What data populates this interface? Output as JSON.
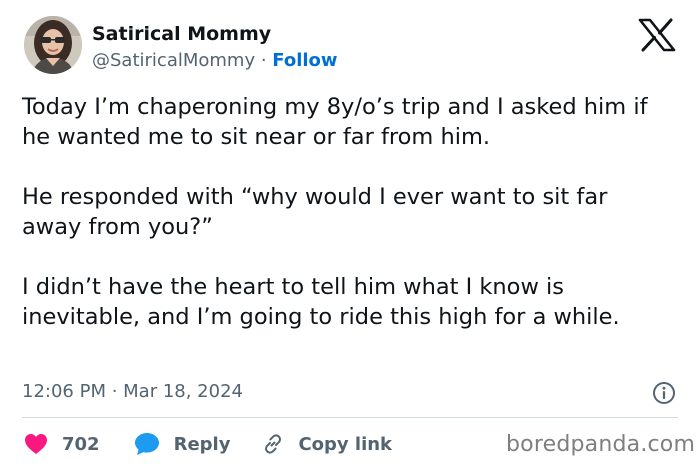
{
  "author": {
    "display_name": "Satirical Mommy",
    "handle": "@SatiricalMommy",
    "separator": " · ",
    "follow_label": "Follow"
  },
  "tweet": {
    "text": "Today I’m chaperoning my 8y/o’s trip and I asked him if he wanted me to sit near or far from him.\n\nHe responded with “why would I ever want to sit far away from you?”\n\nI didn’t have the heart to tell him what I know is inevitable, and I’m going to ride this high for a while.",
    "timestamp": "12:06 PM · Mar 18, 2024"
  },
  "actions": {
    "like_count": "702",
    "reply_label": "Reply",
    "copy_link_label": "Copy link"
  },
  "watermark": "boredpanda.com",
  "icons": {
    "brand": "x-logo-icon",
    "info": "info-icon",
    "like": "heart-icon",
    "reply": "speech-bubble-icon",
    "copy": "link-icon"
  },
  "colors": {
    "like": "#f91880",
    "reply": "#1d9bf0",
    "follow": "#006fd6",
    "text": "#0f1419",
    "secondary": "#536471"
  }
}
